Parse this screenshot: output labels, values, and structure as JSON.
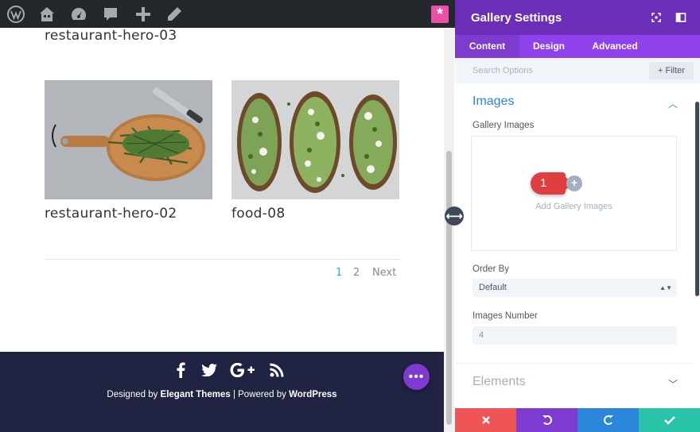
{
  "preview": {
    "top_caption": "restaurant-hero-03",
    "gallery": [
      {
        "caption": "restaurant-hero-02",
        "image": "cutting-board-with-dill-and-knife"
      },
      {
        "caption": "food-08",
        "image": "avocado-toasts-with-greens"
      }
    ],
    "pagination": {
      "current": "1",
      "page_2": "2",
      "next": "Next"
    },
    "footer": {
      "social": [
        "facebook-icon",
        "twitter-icon",
        "google-plus-icon",
        "rss-icon"
      ],
      "credit_prefix": "Designed by ",
      "credit_brand": "Elegant Themes",
      "credit_mid": " | Powered by ",
      "credit_cms": "WordPress"
    },
    "fab_label": "•••"
  },
  "panel": {
    "title": "Gallery Settings",
    "tabs": [
      "Content",
      "Design",
      "Advanced"
    ],
    "search_placeholder": "Search Options",
    "filter_label": "+ Filter",
    "section_images": "Images",
    "gallery_images_label": "Gallery Images",
    "add_gallery_images": "Add Gallery Images",
    "step_badge": "1",
    "order_by_label": "Order By",
    "order_by_value": "Default",
    "images_number_label": "Images Number",
    "images_number_value": "4",
    "section_elements": "Elements"
  },
  "colors": {
    "admin_bar": "#23282d",
    "panel_header": "#6c2eb9",
    "tab_bar": "#8f42ec",
    "accent_blue": "#2b87da",
    "footer_bg": "#202342",
    "cancel": "#ef5555",
    "undo": "#7e3bd0",
    "redo": "#2b87da",
    "save": "#29c4a9"
  }
}
